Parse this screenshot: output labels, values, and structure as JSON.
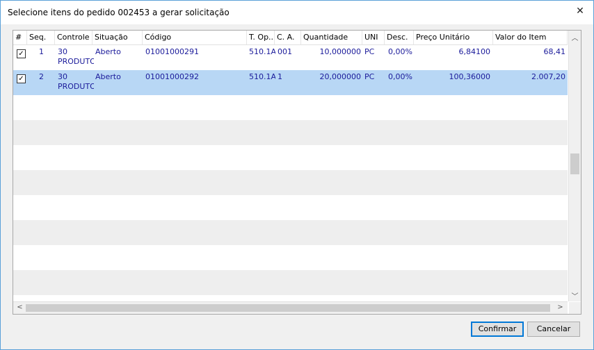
{
  "window": {
    "title": "Selecione itens do pedido 002453 a gerar solicitação",
    "close_glyph": "✕"
  },
  "grid": {
    "columns": [
      "#",
      "Seq.",
      "Controle",
      "Situação",
      "Código",
      "T. Op...",
      "C. A.",
      "Quantidade",
      "UNI",
      "Desc.",
      "Preço Unitário",
      "Valor do Item"
    ],
    "rows": [
      {
        "checked": true,
        "seq": "1",
        "controle": "30",
        "controle2": "PRODUTO",
        "situacao": "Aberto",
        "codigo": "01001000291",
        "top": "510.1A",
        "ca": "001",
        "quantidade": "10,000000",
        "uni": "PC",
        "desc": "0,00%",
        "preco": "6,84100",
        "valor": "68,41"
      },
      {
        "checked": true,
        "seq": "2",
        "controle": "30",
        "controle2": "PRODUTO",
        "situacao": "Aberto",
        "codigo": "01001000292",
        "top": "510.1A",
        "ca": "1",
        "quantidade": "20,000000",
        "uni": "PC",
        "desc": "0,00%",
        "preco": "100,36000",
        "valor": "2.007,20"
      }
    ],
    "checkbox_glyph": "✓",
    "scroll_up": "︿",
    "scroll_down": "﹀",
    "scroll_left": "<",
    "scroll_right": ">"
  },
  "buttons": {
    "confirm": "Confirmar",
    "cancel": "Cancelar"
  },
  "colors": {
    "selected_row": "#b8d7f5",
    "cell_text": "#1a1a9a",
    "window_border": "#5aa0d8"
  }
}
